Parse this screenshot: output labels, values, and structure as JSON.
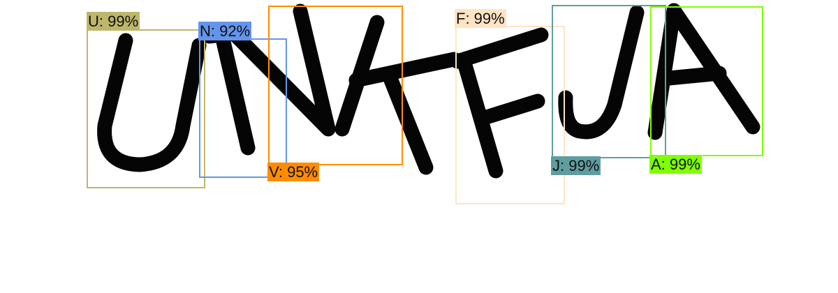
{
  "detections": [
    {
      "id": "u",
      "label": "U: 99%",
      "color": "#BDB76B"
    },
    {
      "id": "n",
      "label": "N: 92%",
      "color": "#6495ED"
    },
    {
      "id": "v",
      "label": "V: 95%",
      "color": "#FF8C00"
    },
    {
      "id": "f",
      "label": "F: 99%",
      "color": "#FFE4C4"
    },
    {
      "id": "j",
      "label": "J: 99%",
      "color": "#5F9EA0"
    },
    {
      "id": "a",
      "label": "A: 99%",
      "color": "#7FFF00"
    }
  ]
}
